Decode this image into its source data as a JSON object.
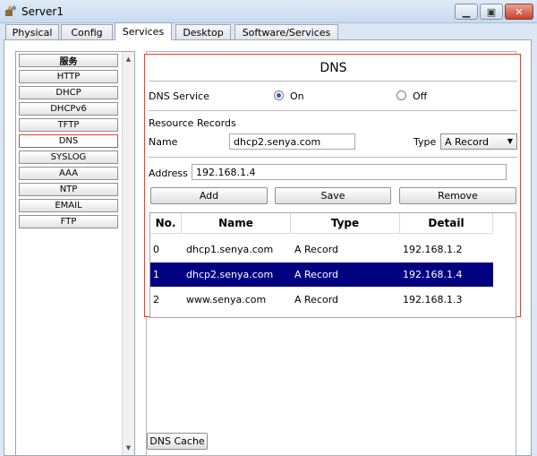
{
  "window": {
    "title": "Server1",
    "minimize_glyph": "▁",
    "maximize_glyph": "▣",
    "close_glyph": "✕"
  },
  "tabs": [
    {
      "label": "Physical"
    },
    {
      "label": "Config"
    },
    {
      "label": "Services"
    },
    {
      "label": "Desktop"
    },
    {
      "label": "Software/Services"
    }
  ],
  "services": {
    "header": "服务",
    "items": [
      "HTTP",
      "DHCP",
      "DHCPv6",
      "TFTP",
      "DNS",
      "SYSLOG",
      "AAA",
      "NTP",
      "EMAIL",
      "FTP"
    ],
    "selected": "DNS",
    "scroll_up_glyph": "▲",
    "scroll_down_glyph": "▼"
  },
  "dns": {
    "title": "DNS",
    "service_label": "DNS Service",
    "on_label": "On",
    "off_label": "Off",
    "service_state": "on",
    "resource_records_label": "Resource Records",
    "name_label": "Name",
    "name_value": "dhcp2.senya.com",
    "type_label": "Type",
    "type_value": "A Record",
    "address_label": "Address",
    "address_value": "192.168.1.4",
    "buttons": {
      "add": "Add",
      "save": "Save",
      "remove": "Remove"
    },
    "table": {
      "headers": [
        "No.",
        "Name",
        "Type",
        "Detail"
      ],
      "rows": [
        {
          "no": "0",
          "name": "dhcp1.senya.com",
          "type": "A Record",
          "detail": "192.168.1.2"
        },
        {
          "no": "1",
          "name": "dhcp2.senya.com",
          "type": "A Record",
          "detail": "192.168.1.4"
        },
        {
          "no": "2",
          "name": "www.senya.com",
          "type": "A Record",
          "detail": "192.168.1.3"
        }
      ],
      "selected_row": 1
    },
    "cache_button": "DNS Cache"
  },
  "colors": {
    "selection_row": "#000080",
    "highlight_border": "#d24a3c",
    "radio_dot": "#2c5fb3"
  },
  "icons": {
    "app": "server-tool-icon",
    "dropdown": "chevron-down-icon"
  }
}
